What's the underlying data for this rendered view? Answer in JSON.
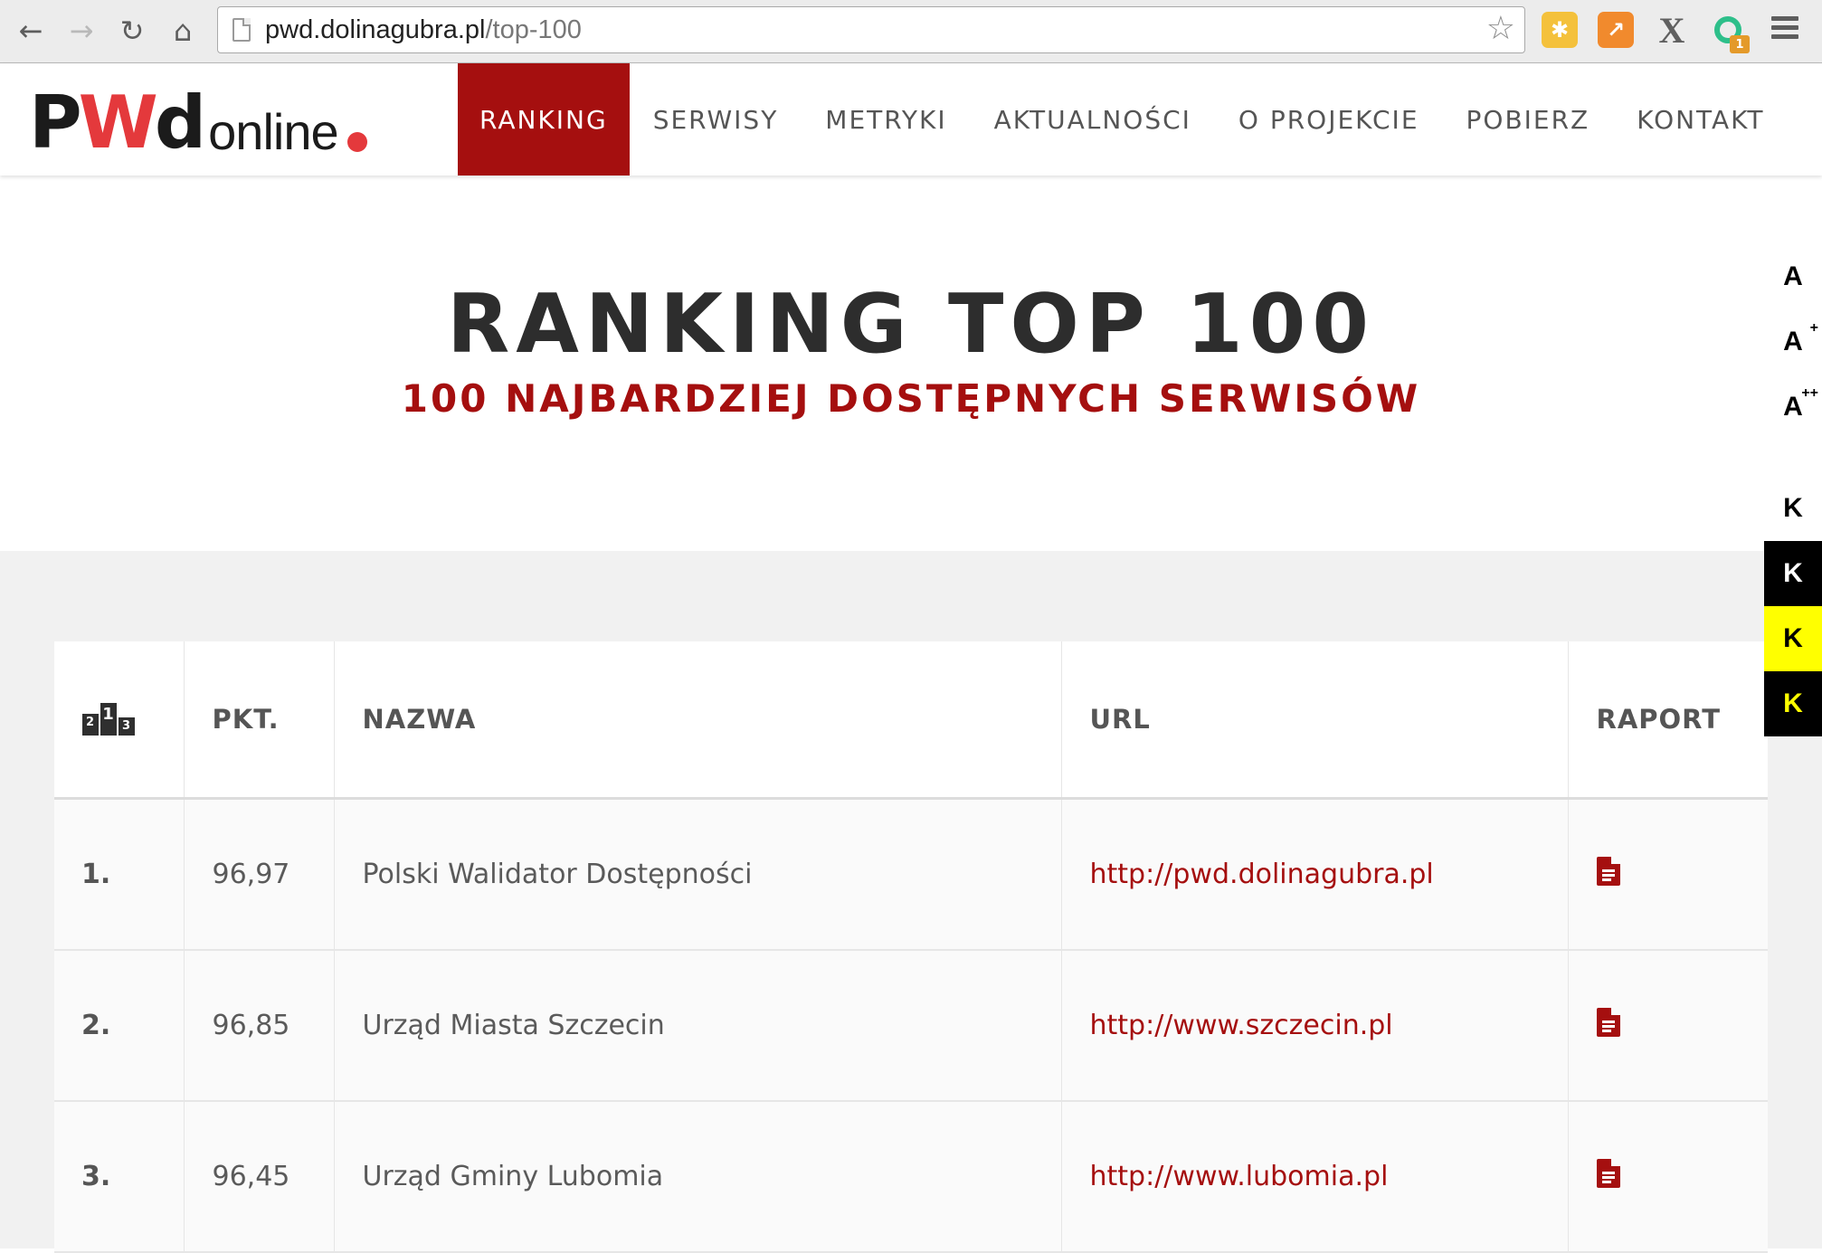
{
  "browser": {
    "url_host": "pwd.dolinagubra.pl",
    "url_path": "/top-100"
  },
  "logo": {
    "p": "P",
    "w": "W",
    "d": "d",
    "online": "online"
  },
  "nav": {
    "items": [
      {
        "label": "RANKING",
        "active": true
      },
      {
        "label": "SERWISY",
        "active": false
      },
      {
        "label": "METRYKI",
        "active": false
      },
      {
        "label": "AKTUALNOŚCI",
        "active": false
      },
      {
        "label": "O PROJEKCIE",
        "active": false
      },
      {
        "label": "POBIERZ",
        "active": false
      },
      {
        "label": "KONTAKT",
        "active": false
      }
    ]
  },
  "hero": {
    "title": "RANKING TOP 100",
    "subtitle": "100 NAJBARDZIEJ DOSTĘPNYCH SERWISÓW"
  },
  "accessibility": {
    "font_sizes": [
      {
        "label": "A",
        "sup": ""
      },
      {
        "label": "A",
        "sup": "+"
      },
      {
        "label": "A",
        "sup": "++"
      }
    ],
    "contrasts": [
      {
        "label": "K"
      },
      {
        "label": "K"
      },
      {
        "label": "K"
      },
      {
        "label": "K"
      }
    ]
  },
  "table": {
    "headers": {
      "pkt": "PKT.",
      "nazwa": "NAZWA",
      "url": "URL",
      "raport": "RAPORT"
    },
    "podium": [
      "2",
      "1",
      "3"
    ],
    "rows": [
      {
        "rank": "1.",
        "pkt": "96,97",
        "nazwa": "Polski Walidator Dostępności",
        "url": "http://pwd.dolinagubra.pl"
      },
      {
        "rank": "2.",
        "pkt": "96,85",
        "nazwa": "Urząd Miasta Szczecin",
        "url": "http://www.szczecin.pl"
      },
      {
        "rank": "3.",
        "pkt": "96,45",
        "nazwa": "Urząd Gminy Lubomia",
        "url": "http://www.lubomia.pl"
      }
    ]
  },
  "colors": {
    "accent": "#a50f0f",
    "logo_red": "#e4393c",
    "contrast_yellow": "#ffff00"
  }
}
